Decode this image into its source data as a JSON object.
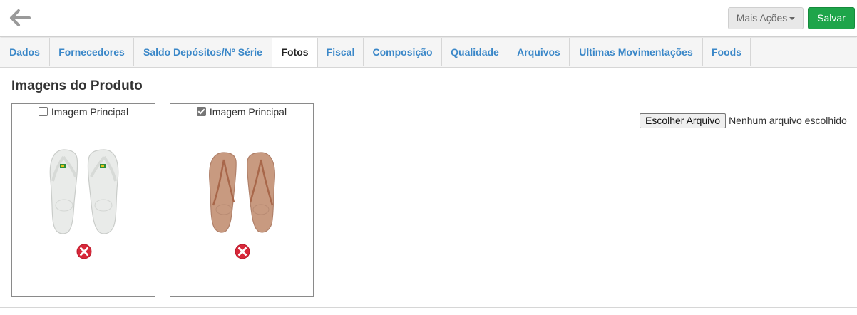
{
  "toolbar": {
    "back_icon": "arrow-left-icon",
    "more_actions_label": "Mais Ações",
    "save_label": "Salvar",
    "save_color": "#1ea54a"
  },
  "tabs": [
    {
      "label": "Dados"
    },
    {
      "label": "Fornecedores"
    },
    {
      "label": "Saldo Depósitos/Nº Série"
    },
    {
      "label": "Fotos",
      "active": true
    },
    {
      "label": "Fiscal"
    },
    {
      "label": "Composição"
    },
    {
      "label": "Qualidade"
    },
    {
      "label": "Arquivos"
    },
    {
      "label": "Ultimas Movimentações"
    },
    {
      "label": "Foods"
    }
  ],
  "section": {
    "title": "Imagens do Produto"
  },
  "images": [
    {
      "main_label": "Imagem Principal",
      "is_main": false,
      "color": "#e9ebe9",
      "delete_icon": "delete-x-icon"
    },
    {
      "main_label": "Imagem Principal",
      "is_main": true,
      "color": "#c89a80",
      "delete_icon": "delete-x-icon"
    }
  ],
  "upload": {
    "button_label": "Escolher Arquivo",
    "status_text": "Nenhum arquivo escolhido"
  }
}
